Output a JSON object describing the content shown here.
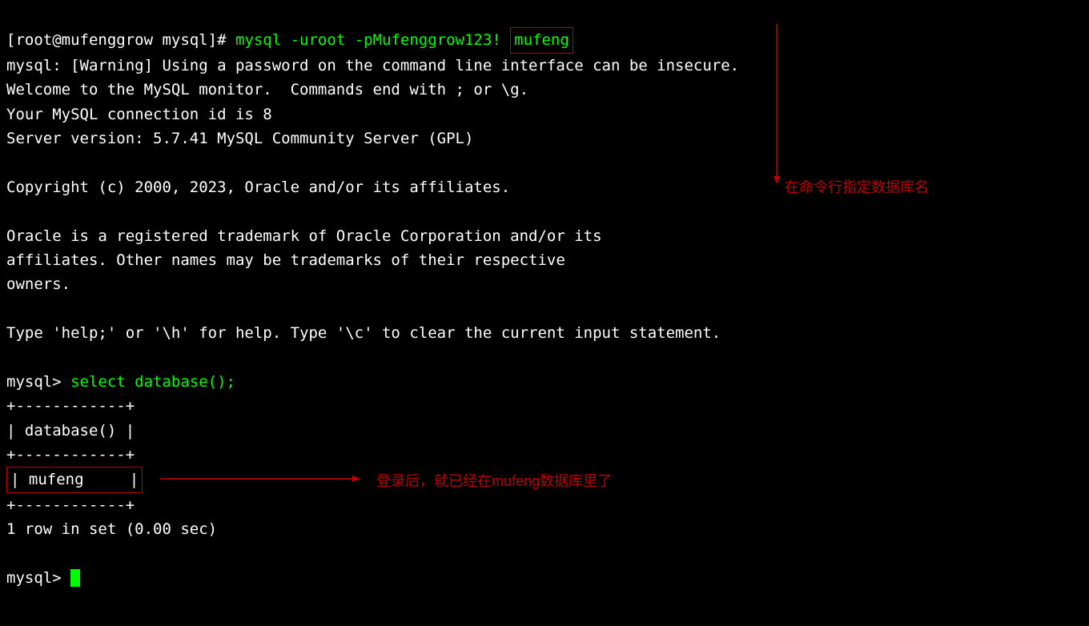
{
  "terminal": {
    "prompt1": "[root@mufenggrow mysql]# ",
    "cmd1_part1": "mysql -uroot -pMufenggrow123! ",
    "cmd1_boxed": "mufeng",
    "warning": "mysql: [Warning] Using a password on the command line interface can be insecure.",
    "welcome": "Welcome to the MySQL monitor.  Commands end with ; or \\g.",
    "conn_id": "Your MySQL connection id is 8",
    "server": "Server version: 5.7.41 MySQL Community Server (GPL)",
    "copyright": "Copyright (c) 2000, 2023, Oracle and/or its affiliates.",
    "oracle1": "Oracle is a registered trademark of Oracle Corporation and/or its",
    "oracle2": "affiliates. Other names may be trademarks of their respective",
    "oracle3": "owners.",
    "help": "Type 'help;' or '\\h' for help. Type '\\c' to clear the current input statement.",
    "prompt_mysql": "mysql> ",
    "query": "select database();",
    "tbl_border": "+------------+",
    "tbl_header": "| database() |",
    "tbl_row_pipe_l": "|",
    "tbl_row_val": " mufeng     ",
    "tbl_row_pipe_r": "|",
    "row_count": "1 row in set (0.00 sec)"
  },
  "annotations": {
    "top_right": "在命令行指定数据库名",
    "middle": "登录后，就已经在mufeng数据库里了"
  }
}
